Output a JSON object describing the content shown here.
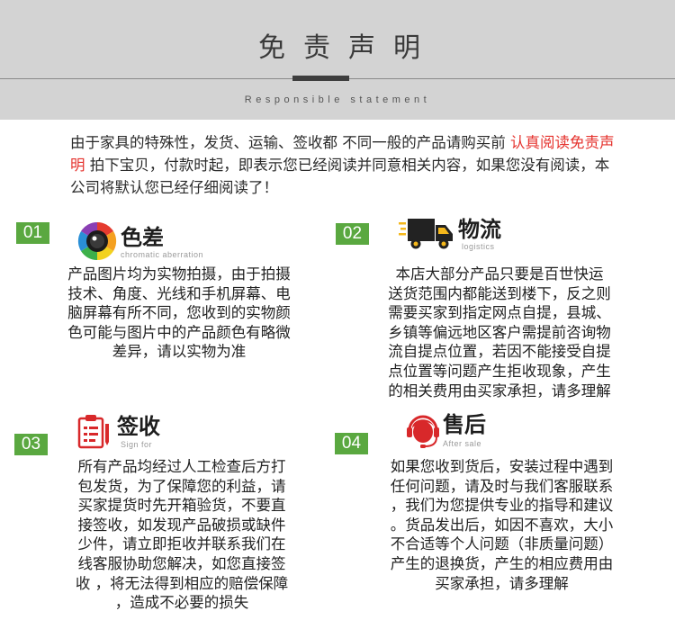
{
  "header": {
    "title": "免责声明",
    "subtitle": "Responsible statement"
  },
  "intro": {
    "text_1": "由于家具的特殊性，发货、运输、签收都 不同一般的产品请购买前 ",
    "highlight": "认真阅读免责声明",
    "text_2": " 拍下宝贝，付款时起，即表示您已经阅读并同意相关内容，如果您没有阅读，本公司将默认您已经仔细阅读了！",
    "highlight_color": "#e5322d"
  },
  "sections": [
    {
      "number": "01",
      "title": "色差",
      "subtitle": "chromatic aberration",
      "icon": "camera-lens-icon",
      "lines": [
        "产品图片均为实物拍摄，由于拍摄",
        "技术、角度、光线和手机屏幕、电",
        "脑屏幕有所不同，您收到的实物颜",
        "色可能与图片中的产品颜色有略微",
        "差异，请以实物为准"
      ]
    },
    {
      "number": "02",
      "title": "物流",
      "subtitle": "logistics",
      "icon": "delivery-truck-icon",
      "lines": [
        "本店大部分产品只要是百世快运",
        "送货范围内都能送到楼下，反之则",
        "需要买家到指定网点自提，县城、",
        "乡镇等偏远地区客户需提前咨询物",
        "流自提点位置，若因不能接受自提",
        "点位置等问题产生拒收现象，产生",
        "的相关费用由买家承担，请多理解"
      ]
    },
    {
      "number": "03",
      "title": "签收",
      "subtitle": "Sign for",
      "icon": "clipboard-icon",
      "lines": [
        "所有产品均经过人工检查后方打",
        "包发货，为了保障您的利益，请",
        "买家提货时先开箱验货，不要直",
        "接签收，如发现产品破损或缺件",
        "少件，请立即拒收并联系我们在",
        "线客服协助您解决，如您直接签",
        "收 ，将无法得到相应的赔偿保障",
        "，造成不必要的损失"
      ]
    },
    {
      "number": "04",
      "title": "售后",
      "subtitle": "After sale",
      "icon": "customer-service-icon",
      "lines": [
        "如果您收到货后，安装过程中遇到",
        "任何问题，请及时与我们客服联系",
        "，我们为您提供专业的指导和建议",
        "。货品发出后，如因不喜欢，大小",
        "不合适等个人问题（非质量问题）",
        "产生的退换货，产生的相应费用由",
        "买家承担，请多理解"
      ]
    }
  ],
  "colors": {
    "header_bg": "#d3d3d3",
    "badge": "#5aa840",
    "icon_dark": "#222222",
    "icon_red": "#d8282a"
  }
}
